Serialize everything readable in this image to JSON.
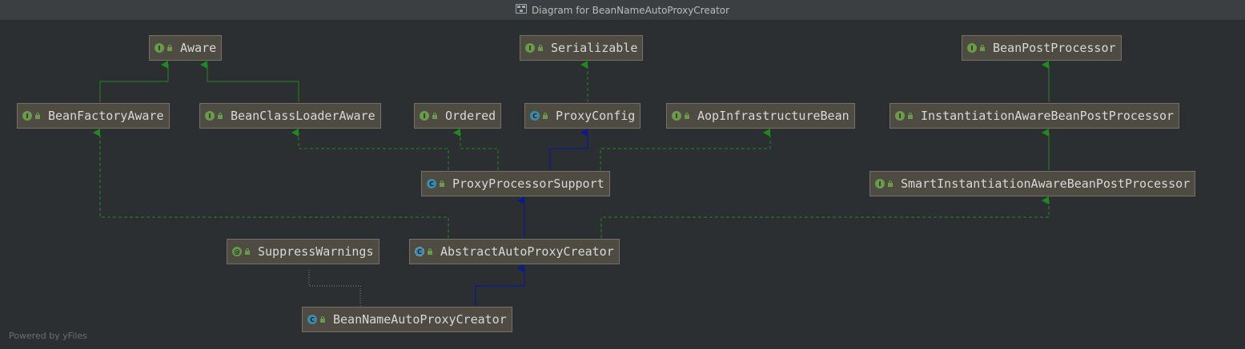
{
  "window": {
    "title": "Diagram for BeanNameAutoProxyCreator",
    "title_icon": "diagram-icon"
  },
  "footer": {
    "text": "Powered by yFiles"
  },
  "colors": {
    "extends_edge": "#0b1a8f",
    "implements_edge": "#1f8a1f",
    "annotation_edge": "#8a8a6a",
    "node_bg": "#4e4b42"
  },
  "nodes": {
    "aware": {
      "label": "Aware",
      "kind": "I"
    },
    "serializable": {
      "label": "Serializable",
      "kind": "I"
    },
    "beanpostprocessor": {
      "label": "BeanPostProcessor",
      "kind": "I"
    },
    "beanfactoryaware": {
      "label": "BeanFactoryAware",
      "kind": "I"
    },
    "beanclassloaderaware": {
      "label": "BeanClassLoaderAware",
      "kind": "I"
    },
    "ordered": {
      "label": "Ordered",
      "kind": "I"
    },
    "proxyconfig": {
      "label": "ProxyConfig",
      "kind": "C"
    },
    "aopinfrastructurebean": {
      "label": "AopInfrastructureBean",
      "kind": "I"
    },
    "instantiationaware": {
      "label": "InstantiationAwareBeanPostProcessor",
      "kind": "I"
    },
    "proxyprocessorsupport": {
      "label": "ProxyProcessorSupport",
      "kind": "C"
    },
    "smartinstantiationaware": {
      "label": "SmartInstantiationAwareBeanPostProcessor",
      "kind": "I"
    },
    "suppresswarnings": {
      "label": "SuppressWarnings",
      "kind": "@"
    },
    "abstractautoproxycreator": {
      "label": "AbstractAutoProxyCreator",
      "kind": "C"
    },
    "beannameautoproxycreator": {
      "label": "BeanNameAutoProxyCreator",
      "kind": "C"
    }
  }
}
